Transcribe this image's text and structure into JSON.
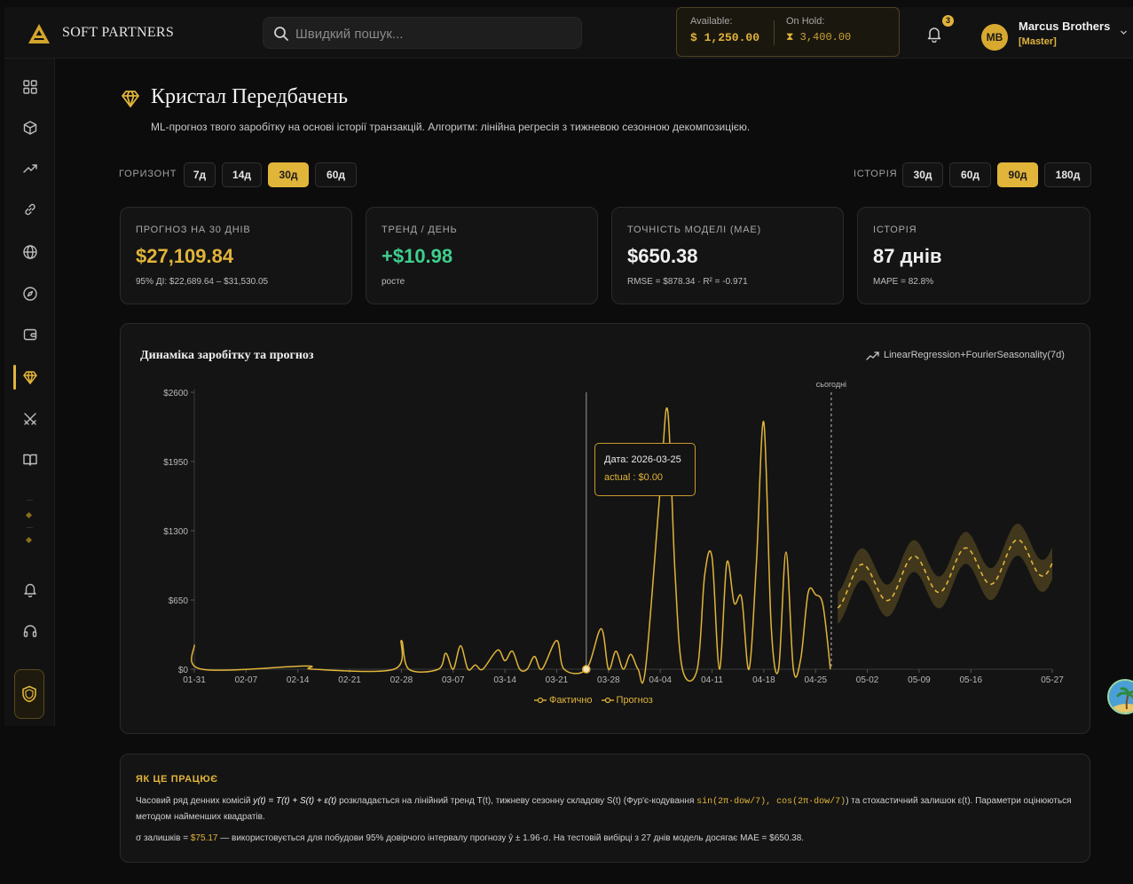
{
  "app": {
    "brand": "SOFT PARTNERS",
    "search_placeholder": "Швидкий пошук...",
    "balance": {
      "available_label": "Available:",
      "available_value": "$ 1,250.00",
      "on_hold_label": "On Hold:",
      "on_hold_value": "3,400.00"
    },
    "notifications_count": "3",
    "user": {
      "initials": "MB",
      "name": "Marcus Brothers",
      "role": "[Master]"
    },
    "accent_color": "#e1b43a"
  },
  "sidebar": {
    "items": [
      {
        "icon": "grid-icon"
      },
      {
        "icon": "cube-icon"
      },
      {
        "icon": "trend-icon"
      },
      {
        "icon": "link-icon"
      },
      {
        "icon": "globe-icon"
      },
      {
        "icon": "compass-icon"
      },
      {
        "icon": "wallet-icon"
      },
      {
        "icon": "gem-icon",
        "active": true
      },
      {
        "icon": "swords-icon"
      },
      {
        "icon": "book-icon"
      },
      {
        "icon": "bell-icon"
      },
      {
        "icon": "headset-icon"
      }
    ]
  },
  "page": {
    "title": "Кристал Передбачень",
    "subtitle": "ML-прогноз твого заробітку на основі історії транзакцій. Алгоритм: лінійна регресія з тижневою сезонною декомпозицією.",
    "horizon": {
      "label": "ГОРИЗОНТ",
      "options": [
        "7д",
        "14д",
        "30д",
        "60д"
      ],
      "selected": "30д"
    },
    "history": {
      "label": "ІСТОРІЯ",
      "options": [
        "30д",
        "60д",
        "90д",
        "180д"
      ],
      "selected": "90д"
    }
  },
  "stats": [
    {
      "label": "ПРОГНОЗ НА 30 ДНІВ",
      "value": "$27,109.84",
      "note": "95% ДІ: $22,689.64 – $31,530.05"
    },
    {
      "label": "ТРЕНД / ДЕНЬ",
      "value": "+$10.98",
      "note": "росте"
    },
    {
      "label": "ТОЧНІСТЬ МОДЕЛІ (MAE)",
      "value": "$650.38",
      "note": "RMSE = $878.34 · R² = -0.971"
    },
    {
      "label": "ІСТОРІЯ",
      "value": "87 днів",
      "note": "MAPE = 82.8%"
    }
  ],
  "chart": {
    "title": "Динаміка заробітку та прогноз",
    "model": "LinearRegression+FourierSeasonality(7d)",
    "today_label": "сьогодні",
    "tooltip": {
      "date": "Дата: 2026-03-25",
      "value": "actual : $0.00"
    },
    "legend": {
      "actual": "Фактично",
      "forecast": "Прогноз"
    }
  },
  "chart_data": {
    "type": "line",
    "title": "Динаміка заробітку та прогноз",
    "ylim": [
      0,
      2600
    ],
    "y_ticks": [
      "$0",
      "$650",
      "$1300",
      "$1950",
      "$2600"
    ],
    "x_ticks": [
      "01-31",
      "02-07",
      "02-14",
      "02-21",
      "02-28",
      "03-07",
      "03-14",
      "03-21",
      "03-28",
      "04-04",
      "04-11",
      "04-18",
      "04-25",
      "05-02",
      "05-09",
      "05-16",
      "05-27"
    ],
    "x_range": [
      "2026-01-31",
      "2026-05-27"
    ],
    "today": "2026-04-27",
    "series": [
      {
        "name": "Фактично",
        "points": [
          [
            "2026-01-31",
            230
          ],
          [
            "2026-02-01",
            0
          ],
          [
            "2026-02-15",
            30
          ],
          [
            "2026-02-16",
            0
          ],
          [
            "2026-02-27",
            0
          ],
          [
            "2026-02-28",
            270
          ],
          [
            "2026-02-29",
            0
          ],
          [
            "2026-03-05",
            0
          ],
          [
            "2026-03-06",
            150
          ],
          [
            "2026-03-07",
            0
          ],
          [
            "2026-03-08",
            220
          ],
          [
            "2026-03-09",
            0
          ],
          [
            "2026-03-10",
            40
          ],
          [
            "2026-03-11",
            0
          ],
          [
            "2026-03-13",
            180
          ],
          [
            "2026-03-14",
            80
          ],
          [
            "2026-03-15",
            170
          ],
          [
            "2026-03-16",
            0
          ],
          [
            "2026-03-17",
            0
          ],
          [
            "2026-03-18",
            120
          ],
          [
            "2026-03-19",
            0
          ],
          [
            "2026-03-21",
            270
          ],
          [
            "2026-03-22",
            0
          ],
          [
            "2026-03-25",
            0
          ],
          [
            "2026-03-27",
            380
          ],
          [
            "2026-03-28",
            0
          ],
          [
            "2026-03-29",
            170
          ],
          [
            "2026-03-30",
            0
          ],
          [
            "2026-03-31",
            140
          ],
          [
            "2026-04-01",
            0
          ],
          [
            "2026-04-02",
            0
          ],
          [
            "2026-04-04",
            1700
          ],
          [
            "2026-04-05",
            2430
          ],
          [
            "2026-04-06",
            900
          ],
          [
            "2026-04-07",
            0
          ],
          [
            "2026-04-09",
            0
          ],
          [
            "2026-04-10",
            880
          ],
          [
            "2026-04-11",
            1050
          ],
          [
            "2026-04-12",
            0
          ],
          [
            "2026-04-13",
            1000
          ],
          [
            "2026-04-14",
            620
          ],
          [
            "2026-04-15",
            670
          ],
          [
            "2026-04-16",
            0
          ],
          [
            "2026-04-17",
            1000
          ],
          [
            "2026-04-18",
            2320
          ],
          [
            "2026-04-19",
            400
          ],
          [
            "2026-04-20",
            0
          ],
          [
            "2026-04-21",
            1100
          ],
          [
            "2026-04-22",
            0
          ],
          [
            "2026-04-23",
            100
          ],
          [
            "2026-04-24",
            720
          ],
          [
            "2026-04-25",
            700
          ],
          [
            "2026-04-26",
            600
          ],
          [
            "2026-04-27",
            0
          ]
        ]
      },
      {
        "name": "Прогноз",
        "start": "2026-04-27",
        "end": "2026-05-27",
        "trend_start": 760,
        "trend_per_day": 10.98,
        "amplitude": 190,
        "period_days": 7,
        "ci_half_width": 150
      }
    ]
  }
}
